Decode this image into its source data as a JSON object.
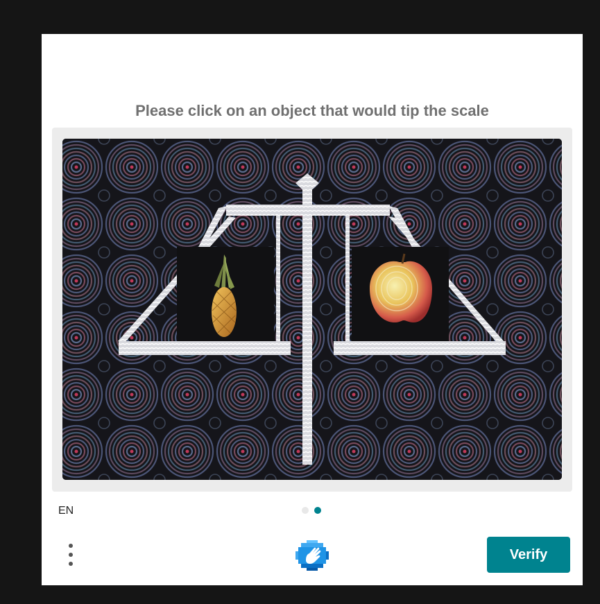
{
  "prompt": "Please click on an object that would tip the scale",
  "challenge": {
    "left_pan_object": "pineapple",
    "right_pan_object": "apple"
  },
  "language": "EN",
  "pagination": {
    "total": 2,
    "current": 2
  },
  "menu_icon": "more-vertical-icon",
  "logo_icon": "hcaptcha-logo-icon",
  "verify_label": "Verify",
  "colors": {
    "background": "#151515",
    "panel": "#ffffff",
    "accent": "#00838f",
    "prompt_text": "#707070",
    "image_frame": "#ececec"
  }
}
